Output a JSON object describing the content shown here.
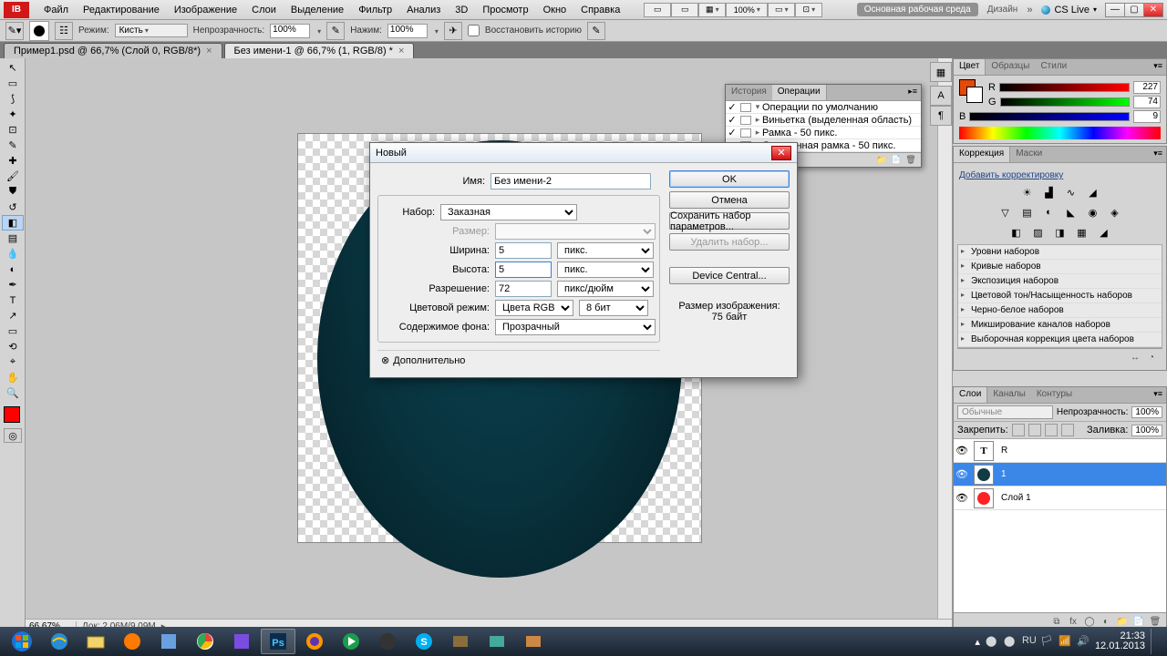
{
  "menubar": {
    "logo": "IB",
    "items": [
      "Файл",
      "Редактирование",
      "Изображение",
      "Слои",
      "Выделение",
      "Фильтр",
      "Анализ",
      "3D",
      "Просмотр",
      "Окно",
      "Справка"
    ],
    "zoom_dd": "100%",
    "workspace_active": "Основная рабочая среда",
    "workspace_other": "Дизайн",
    "cslive": "CS Live"
  },
  "optbar": {
    "mode_label": "Режим:",
    "mode_value": "Кисть",
    "opacity_label": "Непрозрачность:",
    "opacity_value": "100%",
    "flow_label": "Нажим:",
    "flow_value": "100%",
    "restore_label": "Восстановить историю"
  },
  "tabs": [
    {
      "label": "Пример1.psd @ 66,7% (Слой 0, RGB/8*)",
      "active": false
    },
    {
      "label": "Без имени-1 @ 66,7% (1, RGB/8) *",
      "active": true
    }
  ],
  "statusbar": {
    "zoom": "66,67%",
    "doc": "Док: 2,06M/9,09M"
  },
  "color_panel": {
    "tabs": [
      "Цвет",
      "Образцы",
      "Стили"
    ],
    "r": {
      "label": "R",
      "value": "227"
    },
    "g": {
      "label": "G",
      "value": "74"
    },
    "b": {
      "label": "B",
      "value": "9"
    }
  },
  "corrections_panel": {
    "tabs": [
      "Коррекция",
      "Маски"
    ],
    "add_link": "Добавить корректировку",
    "presets": [
      "Уровни наборов",
      "Кривые наборов",
      "Экспозиция наборов",
      "Цветовой тон/Насыщенность наборов",
      "Черно-белое наборов",
      "Микширование каналов наборов",
      "Выборочная коррекция цвета наборов"
    ]
  },
  "layers_panel": {
    "tabs": [
      "Слои",
      "Каналы",
      "Контуры"
    ],
    "blend": "Обычные",
    "opacity_label": "Непрозрачность:",
    "opacity": "100%",
    "lock_label": "Закрепить:",
    "fill_label": "Заливка:",
    "fill": "100%",
    "layers": [
      {
        "name": "R",
        "type": "text"
      },
      {
        "name": "1",
        "type": "circle",
        "selected": true
      },
      {
        "name": "Слой 1",
        "type": "red"
      }
    ]
  },
  "history_panel": {
    "tabs": [
      "История",
      "Операции"
    ],
    "rows": [
      "Операции по умолчанию",
      "Виньетка (выделенная область)",
      "Рамка - 50 пикс.",
      "Деревянная рамка - 50 пикс."
    ]
  },
  "dialog": {
    "title": "Новый",
    "name_label": "Имя:",
    "name_value": "Без имени-2",
    "preset_label": "Набор:",
    "preset_value": "Заказная",
    "size_label": "Размер:",
    "width_label": "Ширина:",
    "width_value": "5",
    "width_unit": "пикс.",
    "height_label": "Высота:",
    "height_value": "5",
    "height_unit": "пикс.",
    "res_label": "Разрешение:",
    "res_value": "72",
    "res_unit": "пикс/дюйм",
    "mode_label": "Цветовой режим:",
    "mode_value": "Цвета RGB",
    "depth_value": "8 бит",
    "bg_label": "Содержимое фона:",
    "bg_value": "Прозрачный",
    "adv_label": "Дополнительно",
    "ok": "OK",
    "cancel": "Отмена",
    "save_preset": "Сохранить набор параметров...",
    "delete_preset": "Удалить набор...",
    "device_central": "Device Central...",
    "size_info_label": "Размер изображения:",
    "size_info": "75 байт"
  },
  "taskbar": {
    "time": "21:33",
    "date": "12.01.2013"
  }
}
